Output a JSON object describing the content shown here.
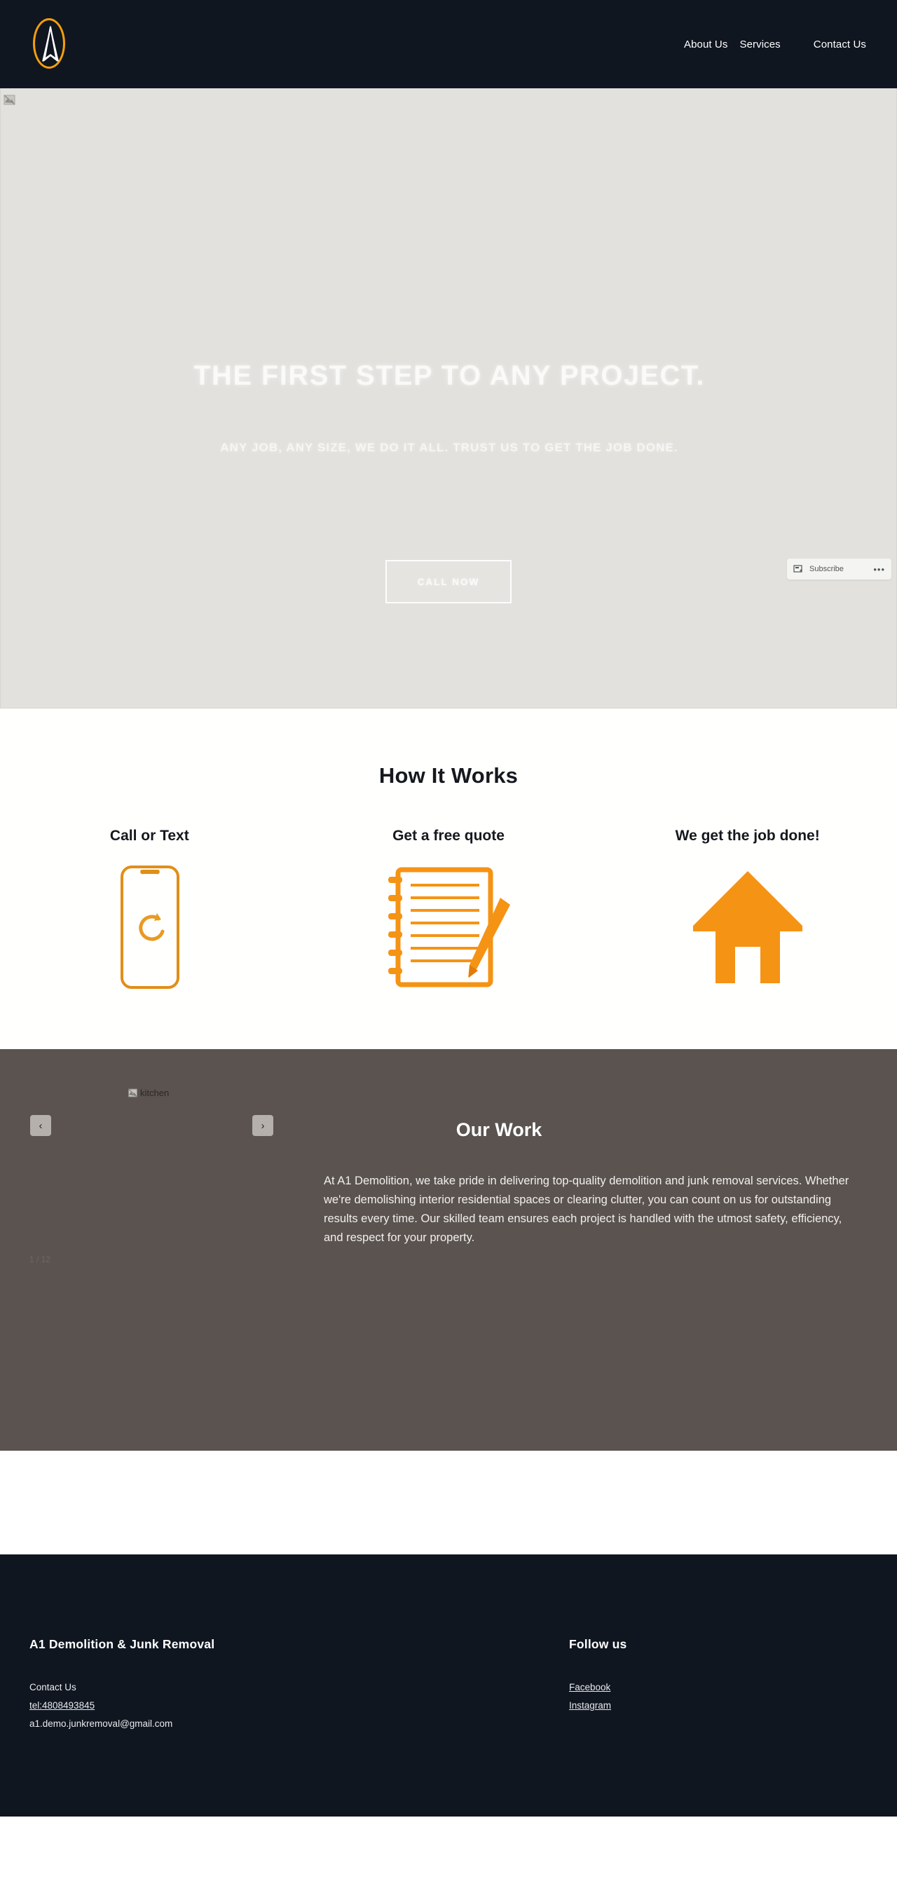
{
  "brand": {
    "logo_icon": "a1-logo-icon",
    "accent_color": "#f59e0b",
    "dark_color": "#0f1620"
  },
  "header": {
    "nav": [
      {
        "label": "About Us",
        "name": "nav-about-us"
      },
      {
        "label": "Services",
        "name": "nav-services"
      },
      {
        "label": "Contact Us",
        "name": "nav-contact-us"
      }
    ]
  },
  "hero": {
    "title": "THE FIRST STEP TO ANY PROJECT.",
    "subtitle": "ANY JOB, ANY SIZE, WE DO IT ALL. TRUST US TO GET THE JOB DONE.",
    "cta_label": "CALL NOW",
    "broken_image_icon": "broken-image-icon",
    "video_overlay": {
      "subscribe_label": "Subscribe",
      "subscribe_icon": "youtube-subscribe-icon",
      "more_label": "•••"
    }
  },
  "how_it_works": {
    "title": "How It Works",
    "steps": [
      {
        "label": "Call or Text",
        "icon": "mobile-phone-icon"
      },
      {
        "label": "Get a free quote",
        "icon": "notepad-pencil-icon"
      },
      {
        "label": "We get the job done!",
        "icon": "house-icon"
      }
    ]
  },
  "our_work": {
    "title": "Our Work",
    "body": "At A1 Demolition, we take pride in delivering top-quality demolition and junk removal services. Whether we're demolishing interior residential spaces or clearing clutter, you can count on us for outstanding results every time. Our skilled team ensures each project is handled with the utmost safety, efficiency, and respect for your property.",
    "gallery": {
      "image_alt": "kitchen",
      "broken_image_icon": "broken-image-icon",
      "prev_label": "‹",
      "next_label": "›",
      "counter": "1 / 12"
    }
  },
  "footer": {
    "left": {
      "heading": "A1 Demolition & Junk Removal",
      "contact_label": "Contact Us",
      "phone": "tel:4808493845",
      "email": "a1.demo.junkremoval@gmail.com"
    },
    "right": {
      "heading": "Follow us",
      "links": [
        {
          "label": "Facebook",
          "name": "footer-link-facebook"
        },
        {
          "label": "Instagram",
          "name": "footer-link-instagram"
        }
      ]
    }
  }
}
